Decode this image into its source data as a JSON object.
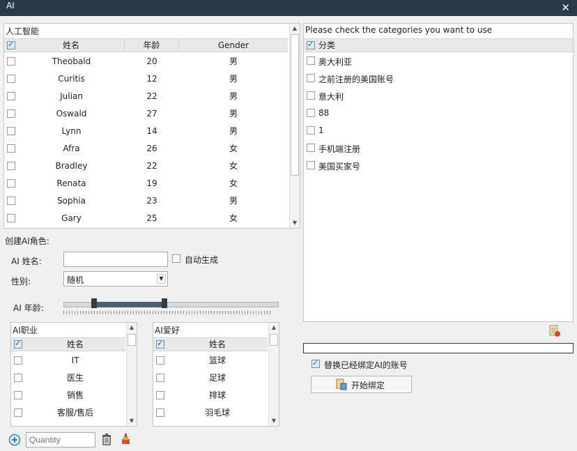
{
  "window": {
    "title": "AI",
    "close_symbol": "✕"
  },
  "left_panel": {
    "caption": "人工智能",
    "columns": [
      "姓名",
      "年龄",
      "Gender"
    ],
    "rows": [
      {
        "name": "Theobald",
        "age": "20",
        "gender": "男"
      },
      {
        "name": "Curitis",
        "age": "12",
        "gender": "男"
      },
      {
        "name": "Julian",
        "age": "22",
        "gender": "男"
      },
      {
        "name": "Oswald",
        "age": "27",
        "gender": "男"
      },
      {
        "name": "Lynn",
        "age": "14",
        "gender": "男"
      },
      {
        "name": "Afra",
        "age": "26",
        "gender": "女"
      },
      {
        "name": "Bradley",
        "age": "22",
        "gender": "女"
      },
      {
        "name": "Renata",
        "age": "19",
        "gender": "女"
      },
      {
        "name": "Sophia",
        "age": "23",
        "gender": "男"
      },
      {
        "name": "Gary",
        "age": "25",
        "gender": "女"
      }
    ]
  },
  "create_form": {
    "section_label": "创建AI角色:",
    "name_label": "AI 姓名:",
    "name_value": "",
    "auto_generate_label": "自动生成",
    "auto_generate_checked": false,
    "gender_label": "性别:",
    "gender_value": "随机",
    "age_label": "AI 年龄:"
  },
  "job_list": {
    "caption": "AI职业",
    "column": "姓名",
    "items": [
      "IT",
      "医生",
      "销售",
      "客服/售后"
    ]
  },
  "hobby_list": {
    "caption": "AI爱好",
    "column": "姓名",
    "items": [
      "篮球",
      "足球",
      "排球",
      "羽毛球"
    ]
  },
  "bottom_toolbar": {
    "quantity_placeholder": "Quantity"
  },
  "right_panel": {
    "caption": "Please check the categories you want to use",
    "header": "分类",
    "categories": [
      "奥大利亚",
      "之前注册的美国账号",
      "意大利",
      "88",
      "1",
      "手机端注册",
      "美国买家号"
    ]
  },
  "bind_section": {
    "replace_label": "替换已经绑定AI的账号",
    "replace_checked": true,
    "start_button_label": "开始绑定"
  },
  "colors": {
    "titlebar": "#2b3a48",
    "header_bg": "#e9e9e9",
    "slider_fill": "#4f5f6d",
    "accent_blue": "#2c5fa0"
  }
}
